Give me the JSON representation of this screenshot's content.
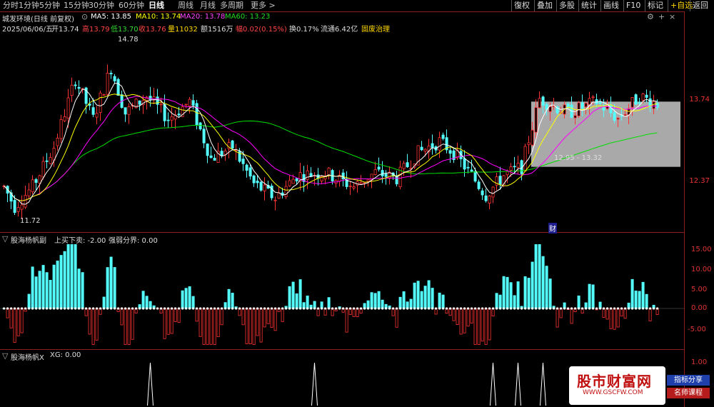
{
  "toolbar": {
    "periods": [
      "分时",
      "1分钟",
      "5分钟",
      "15分钟",
      "30分钟",
      "60分钟",
      "日线",
      "周线",
      "月线",
      "多周期",
      "更多 >"
    ],
    "active_period": "日线",
    "buttons": [
      "復权",
      "叠加",
      "多股",
      "统计",
      "画线",
      "F10",
      "标记",
      "+自选",
      "返回"
    ]
  },
  "header": {
    "stock": "城发环境(日线 前复权)",
    "ma5_label": "MA5: 13.85",
    "ma10_label": "MA10: 13.74",
    "ma20_label": "MA20: 13.78",
    "ma60_label": "MA60: 13.23",
    "date": "2025/06/06/五",
    "open": "开13.74",
    "high": "高13.79",
    "low": "低13.70",
    "close": "收13.76",
    "volume": "量11032",
    "amount": "额1516万",
    "change": "幅0.02(0.15%)",
    "turnover": "换0.17%",
    "float_cap": "流通6.42亿",
    "concept": "固废治理"
  },
  "colors": {
    "up": "#ff3333",
    "down": "#54ffff",
    "ma5": "#ffffff",
    "ma10": "#ffff00",
    "ma20": "#ff00ff",
    "ma60": "#00e000",
    "axis": "#dd3333",
    "zone": "#a9a9a9"
  },
  "main_chart": {
    "price_ticks": [
      "13.74",
      "12.37"
    ],
    "high_mark": "14.78",
    "low_mark": "11.72",
    "zone_label": "12.95 - 13.32",
    "finance_mark": "财"
  },
  "indicator1": {
    "title": "股海杨帆副",
    "line1": "上买下卖: -2.00",
    "line2": "强弱分界: 0.00",
    "ticks": [
      "15.00",
      "10.00",
      "5.00",
      "0.00",
      "-5.00"
    ]
  },
  "indicator2": {
    "title": "股海杨帆X",
    "line1": "XG: 0.00",
    "ticks": [
      "1.00"
    ]
  },
  "watermark": {
    "main": "股市财富网",
    "url": "WWW.GSCFW.COM",
    "tag1": "指标分享",
    "tag2": "名师课程"
  }
}
